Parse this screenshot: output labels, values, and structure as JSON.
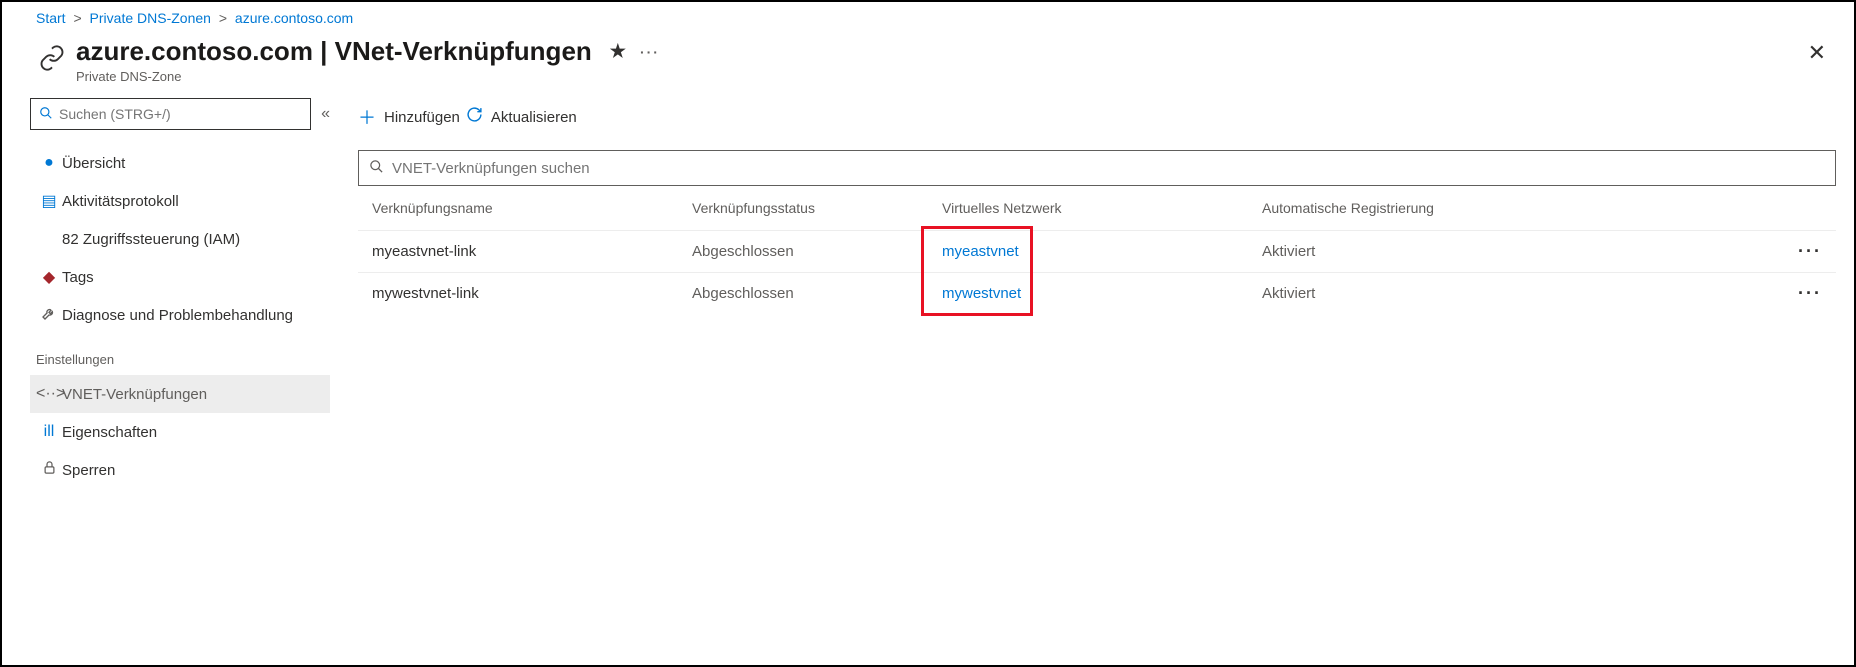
{
  "breadcrumb": {
    "start": "Start",
    "zones": "Private DNS-Zonen",
    "domain": "azure.contoso.com"
  },
  "header": {
    "title": "azure.contoso.com | VNet-Verknüpfungen",
    "subtitle": "Private DNS-Zone"
  },
  "sidebar": {
    "search_placeholder": "Suchen (STRG+/)",
    "items": {
      "overview": "Übersicht",
      "activity": "Aktivitätsprotokoll",
      "iam": "82 Zugriffssteuerung (IAM)",
      "tags": "Tags",
      "diag": "Diagnose und Problembehandlung"
    },
    "settings_label": "Einstellungen",
    "settings": {
      "vnet": "VNET-Verknüpfungen",
      "props": "Eigenschaften",
      "locks": "Sperren"
    }
  },
  "toolbar": {
    "add": "Hinzufügen",
    "refresh": "Aktualisieren"
  },
  "filter": {
    "placeholder": "VNET-Verknüpfungen suchen"
  },
  "columns": {
    "name": "Verknüpfungsname",
    "status": "Verknüpfungsstatus",
    "vnet": "Virtuelles Netzwerk",
    "auto": "Automatische Registrierung"
  },
  "rows": [
    {
      "name": "myeastvnet-link",
      "status": "Abgeschlossen",
      "vnet": "myeastvnet",
      "auto": "Aktiviert"
    },
    {
      "name": "mywestvnet-link",
      "status": "Abgeschlossen",
      "vnet": "mywestvnet",
      "auto": "Aktiviert"
    }
  ]
}
